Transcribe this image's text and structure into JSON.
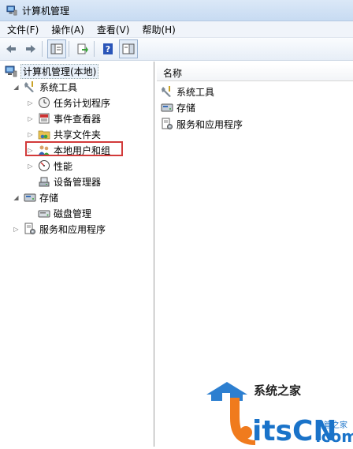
{
  "window": {
    "title": "计算机管理"
  },
  "menu": [
    "文件(F)",
    "操作(A)",
    "查看(V)",
    "帮助(H)"
  ],
  "toolbar": {
    "buttons": [
      "back-icon",
      "forward-icon",
      "show-hide-tree-icon",
      "export-icon",
      "help-icon",
      "properties-icon"
    ]
  },
  "tree": {
    "root": "计算机管理(本地)",
    "system_tools": "系统工具",
    "task_scheduler": "任务计划程序",
    "event_viewer": "事件查看器",
    "shared_folders": "共享文件夹",
    "local_users": "本地用户和组",
    "performance": "性能",
    "device_manager": "设备管理器",
    "storage": "存储",
    "disk_management": "磁盘管理",
    "services_apps": "服务和应用程序"
  },
  "list": {
    "column_name": "名称",
    "items": [
      "系统工具",
      "存储",
      "服务和应用程序"
    ]
  },
  "watermark": {
    "line1": "系统之家",
    "brand": "itsCN",
    "dotcom": ".com",
    "sub": "网管之家"
  },
  "colors": {
    "highlight": "#d23a3a",
    "brand_blue": "#1a73c9",
    "brand_orange": "#f07b1d"
  }
}
